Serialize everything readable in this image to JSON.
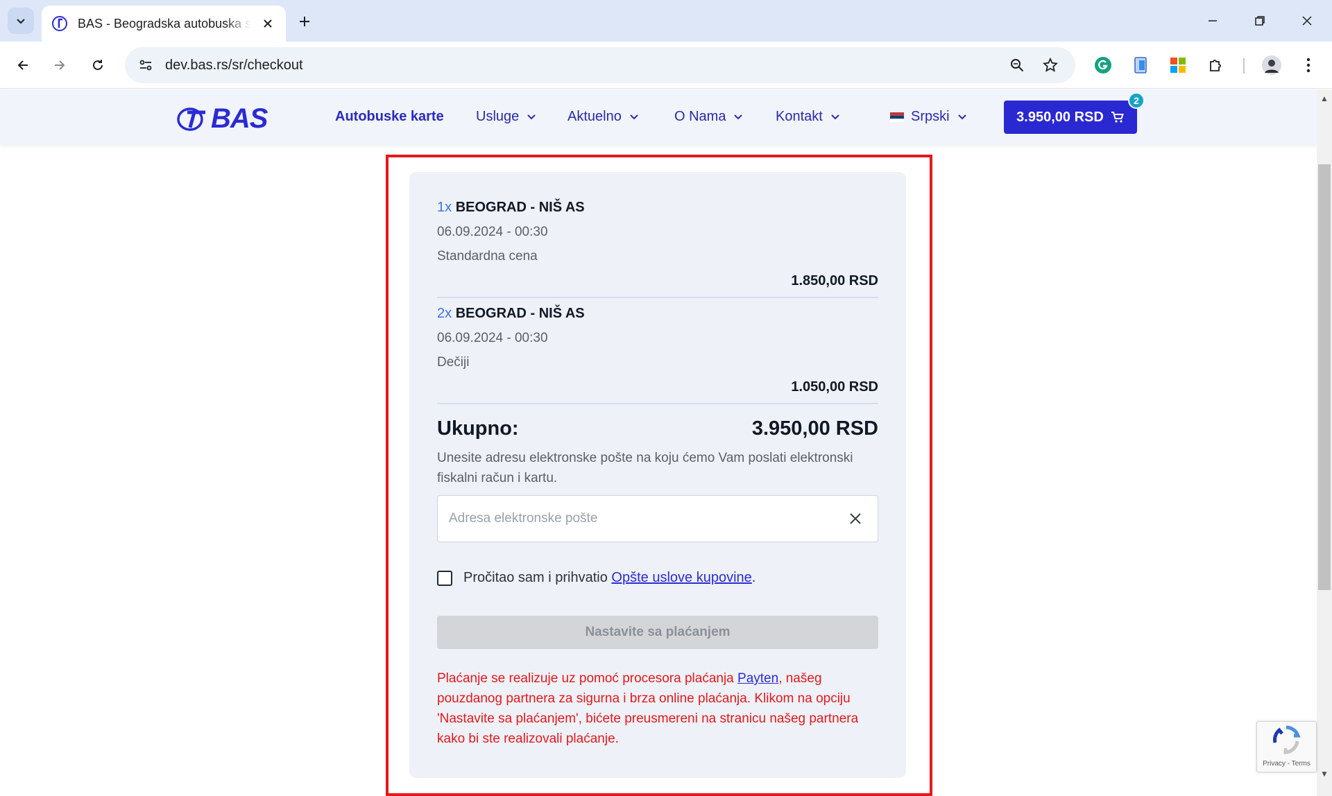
{
  "browser": {
    "tab_title": "BAS - Beogradska autobuska stanica",
    "url": "dev.bas.rs/sr/checkout"
  },
  "site": {
    "logo_text": "BAS",
    "nav": {
      "bus_tickets": "Autobuske karte",
      "services": "Usluge",
      "news": "Aktuelno",
      "about": "O Nama",
      "contact": "Kontakt",
      "language": "Srpski"
    },
    "cart_total": "3.950,00 RSD",
    "cart_count": "2"
  },
  "checkout": {
    "items": [
      {
        "qty": "1x",
        "route": "BEOGRAD - NIŠ AS",
        "datetime": "06.09.2024 - 00:30",
        "fare": "Standardna cena",
        "price": "1.850,00 RSD"
      },
      {
        "qty": "2x",
        "route": "BEOGRAD - NIŠ AS",
        "datetime": "06.09.2024 - 00:30",
        "fare": "Dečiji",
        "price": "1.050,00 RSD"
      }
    ],
    "total_label": "Ukupno:",
    "total_value": "3.950,00 RSD",
    "email_info": "Unesite adresu elektronske pošte na koju ćemo Vam poslati elektronski fiskalni račun i kartu.",
    "email_placeholder": "Adresa elektronske pošte",
    "terms_prefix": "Pročitao sam i prihvatio ",
    "terms_link": "Opšte uslove kupovine",
    "terms_suffix": ".",
    "pay_button": "Nastavite sa plaćanjem",
    "payten_prefix": "Plaćanje se realizuje uz pomoć procesora plaćanja ",
    "payten_link": "Payten",
    "payten_suffix": ", našeg pouzdanog partnera za sigurna i brza online plaćanja. Klikom na opciju 'Nastavite sa plaćanjem', bićete preusmereni na stranicu našeg partnera kako bi ste realizovali plaćanje."
  },
  "recaptcha": {
    "text": "Privacy - Terms"
  },
  "colors": {
    "brand": "#2a28d0",
    "highlight": "#e3191c",
    "warning_text": "#e3191c"
  }
}
